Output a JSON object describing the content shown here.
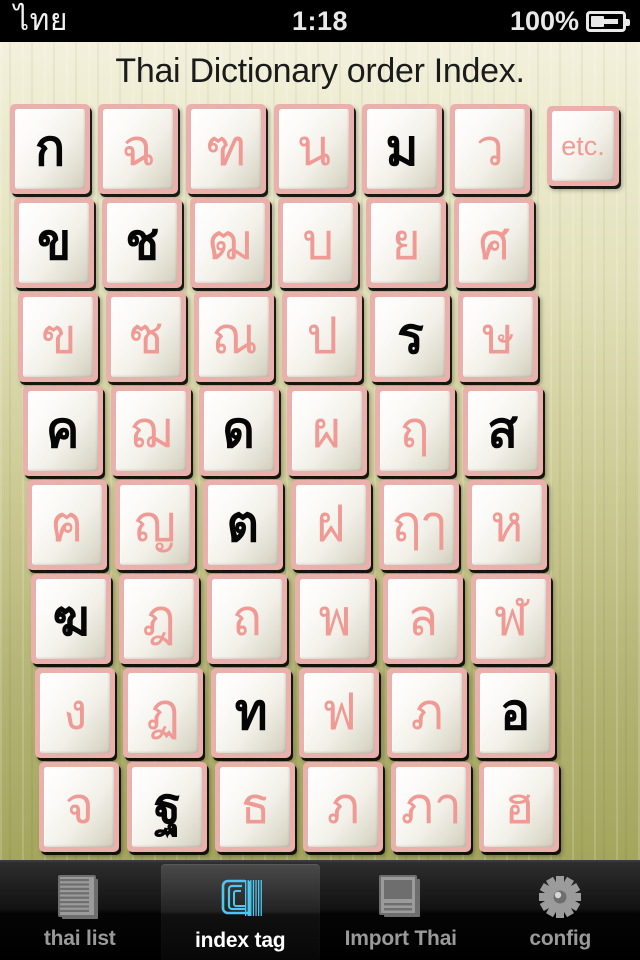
{
  "statusbar": {
    "carrier": "ไทย",
    "time": "1:18",
    "battery_percent": "100%",
    "battery_icon": "battery-charging-icon"
  },
  "header": {
    "title": "Thai Dictionary order Index."
  },
  "grid": {
    "columns": 6,
    "rows": [
      [
        {
          "label": "ก",
          "style": "black"
        },
        {
          "label": "ฉ",
          "style": "pink"
        },
        {
          "label": "ฑ",
          "style": "pink"
        },
        {
          "label": "น",
          "style": "pink"
        },
        {
          "label": "ม",
          "style": "black"
        },
        {
          "label": "ว",
          "style": "pink"
        }
      ],
      [
        {
          "label": "ข",
          "style": "black"
        },
        {
          "label": "ช",
          "style": "black"
        },
        {
          "label": "ฒ",
          "style": "pink"
        },
        {
          "label": "บ",
          "style": "pink"
        },
        {
          "label": "ย",
          "style": "pink"
        },
        {
          "label": "ศ",
          "style": "pink"
        }
      ],
      [
        {
          "label": "ฃ",
          "style": "pink"
        },
        {
          "label": "ซ",
          "style": "pink"
        },
        {
          "label": "ณ",
          "style": "pink"
        },
        {
          "label": "ป",
          "style": "pink"
        },
        {
          "label": "ร",
          "style": "black"
        },
        {
          "label": "ษ",
          "style": "pink"
        }
      ],
      [
        {
          "label": "ค",
          "style": "black"
        },
        {
          "label": "ฌ",
          "style": "pink"
        },
        {
          "label": "ด",
          "style": "black"
        },
        {
          "label": "ผ",
          "style": "pink"
        },
        {
          "label": "ฤ",
          "style": "pink"
        },
        {
          "label": "ส",
          "style": "black"
        }
      ],
      [
        {
          "label": "ฅ",
          "style": "pink"
        },
        {
          "label": "ญ",
          "style": "pink"
        },
        {
          "label": "ต",
          "style": "black"
        },
        {
          "label": "ฝ",
          "style": "pink"
        },
        {
          "label": "ฤๅ",
          "style": "pink"
        },
        {
          "label": "ห",
          "style": "pink"
        }
      ],
      [
        {
          "label": "ฆ",
          "style": "black"
        },
        {
          "label": "ฎ",
          "style": "pink"
        },
        {
          "label": "ถ",
          "style": "pink"
        },
        {
          "label": "พ",
          "style": "pink"
        },
        {
          "label": "ล",
          "style": "pink"
        },
        {
          "label": "ฬ",
          "style": "pink"
        }
      ],
      [
        {
          "label": "ง",
          "style": "pink"
        },
        {
          "label": "ฏ",
          "style": "pink"
        },
        {
          "label": "ท",
          "style": "black"
        },
        {
          "label": "ฟ",
          "style": "pink"
        },
        {
          "label": "ภ",
          "style": "pink"
        },
        {
          "label": "อ",
          "style": "black"
        }
      ],
      [
        {
          "label": "จ",
          "style": "pink"
        },
        {
          "label": "ฐ",
          "style": "black"
        },
        {
          "label": "ธ",
          "style": "pink"
        },
        {
          "label": "ภ",
          "style": "pink"
        },
        {
          "label": "ภา",
          "style": "pink"
        },
        {
          "label": "ฮ",
          "style": "pink"
        }
      ]
    ],
    "extra_tile": {
      "label": "etc.",
      "style": "pink"
    }
  },
  "tabbar": {
    "items": [
      {
        "label": "thai list",
        "icon": "lined-document-icon",
        "active": false
      },
      {
        "label": "index tag",
        "icon": "tabbed-pages-icon",
        "active": true
      },
      {
        "label": "Import Thai",
        "icon": "window-document-icon",
        "active": false
      },
      {
        "label": "config",
        "icon": "gear-icon",
        "active": false
      }
    ]
  },
  "colors": {
    "tile_border": "#eab0ac",
    "glyph_pink": "#ef9a94",
    "glyph_black": "#050505",
    "background_top": "#f3f1dc",
    "background_bottom": "#a4a65d",
    "tab_active_icon": "#4dc6f0"
  }
}
